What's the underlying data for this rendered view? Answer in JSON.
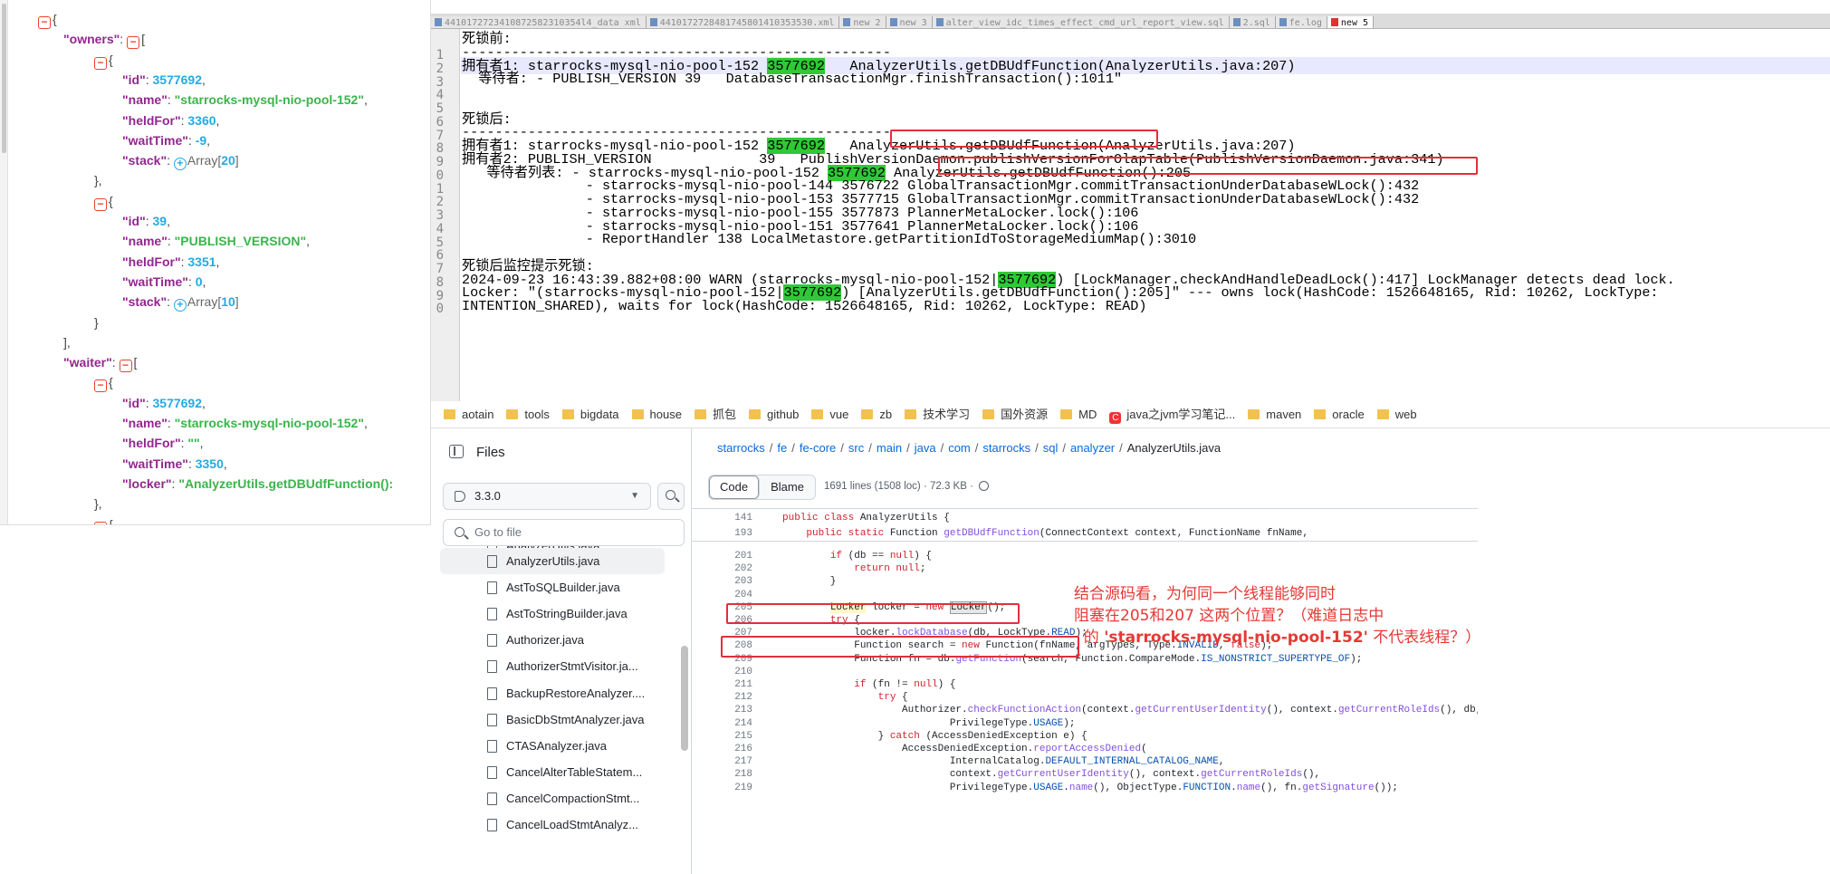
{
  "json_viewer": {
    "lines": [
      {
        "indent": 0,
        "parts": [
          {
            "t": "tog",
            "v": "−"
          },
          {
            "t": "txt",
            "v": "{"
          }
        ]
      },
      {
        "indent": 1,
        "parts": [
          {
            "t": "key",
            "v": "\"owners\""
          },
          {
            "t": "txt",
            "v": ": "
          },
          {
            "t": "tog",
            "v": "−"
          },
          {
            "t": "txt",
            "v": "["
          }
        ]
      },
      {
        "indent": 2,
        "parts": [
          {
            "t": "tog",
            "v": "−"
          },
          {
            "t": "txt",
            "v": "{"
          }
        ]
      },
      {
        "indent": 3,
        "parts": [
          {
            "t": "key",
            "v": "\"id\""
          },
          {
            "t": "txt",
            "v": ": "
          },
          {
            "t": "num",
            "v": "3577692"
          },
          {
            "t": "txt",
            "v": ","
          }
        ]
      },
      {
        "indent": 3,
        "parts": [
          {
            "t": "key",
            "v": "\"name\""
          },
          {
            "t": "txt",
            "v": ": "
          },
          {
            "t": "str",
            "v": "\"starrocks-mysql-nio-pool-152\""
          },
          {
            "t": "txt",
            "v": ","
          }
        ]
      },
      {
        "indent": 3,
        "parts": [
          {
            "t": "key",
            "v": "\"heldFor\""
          },
          {
            "t": "txt",
            "v": ": "
          },
          {
            "t": "num",
            "v": "3360"
          },
          {
            "t": "txt",
            "v": ","
          }
        ]
      },
      {
        "indent": 3,
        "parts": [
          {
            "t": "key",
            "v": "\"waitTime\""
          },
          {
            "t": "txt",
            "v": ": "
          },
          {
            "t": "num",
            "v": "-9"
          },
          {
            "t": "txt",
            "v": ","
          }
        ]
      },
      {
        "indent": 3,
        "parts": [
          {
            "t": "key",
            "v": "\"stack\""
          },
          {
            "t": "txt",
            "v": ": "
          },
          {
            "t": "plus",
            "v": "+"
          },
          {
            "t": "arr",
            "v": "Array["
          },
          {
            "t": "arrn",
            "v": "20"
          },
          {
            "t": "arr",
            "v": "]"
          }
        ]
      },
      {
        "indent": 2,
        "parts": [
          {
            "t": "txt",
            "v": "},"
          }
        ]
      },
      {
        "indent": 2,
        "parts": [
          {
            "t": "tog",
            "v": "−"
          },
          {
            "t": "txt",
            "v": "{"
          }
        ]
      },
      {
        "indent": 3,
        "parts": [
          {
            "t": "key",
            "v": "\"id\""
          },
          {
            "t": "txt",
            "v": ": "
          },
          {
            "t": "num",
            "v": "39"
          },
          {
            "t": "txt",
            "v": ","
          }
        ]
      },
      {
        "indent": 3,
        "parts": [
          {
            "t": "key",
            "v": "\"name\""
          },
          {
            "t": "txt",
            "v": ": "
          },
          {
            "t": "str",
            "v": "\"PUBLISH_VERSION\""
          },
          {
            "t": "txt",
            "v": ","
          }
        ]
      },
      {
        "indent": 3,
        "parts": [
          {
            "t": "key",
            "v": "\"heldFor\""
          },
          {
            "t": "txt",
            "v": ": "
          },
          {
            "t": "num",
            "v": "3351"
          },
          {
            "t": "txt",
            "v": ","
          }
        ]
      },
      {
        "indent": 3,
        "parts": [
          {
            "t": "key",
            "v": "\"waitTime\""
          },
          {
            "t": "txt",
            "v": ": "
          },
          {
            "t": "num",
            "v": "0"
          },
          {
            "t": "txt",
            "v": ","
          }
        ]
      },
      {
        "indent": 3,
        "parts": [
          {
            "t": "key",
            "v": "\"stack\""
          },
          {
            "t": "txt",
            "v": ": "
          },
          {
            "t": "plus",
            "v": "+"
          },
          {
            "t": "arr",
            "v": "Array["
          },
          {
            "t": "arrn",
            "v": "10"
          },
          {
            "t": "arr",
            "v": "]"
          }
        ]
      },
      {
        "indent": 2,
        "parts": [
          {
            "t": "txt",
            "v": "}"
          }
        ]
      },
      {
        "indent": 1,
        "parts": [
          {
            "t": "txt",
            "v": "],"
          }
        ]
      },
      {
        "indent": 1,
        "parts": [
          {
            "t": "key",
            "v": "\"waiter\""
          },
          {
            "t": "txt",
            "v": ": "
          },
          {
            "t": "tog",
            "v": "−"
          },
          {
            "t": "txt",
            "v": "["
          }
        ]
      },
      {
        "indent": 2,
        "parts": [
          {
            "t": "tog",
            "v": "−"
          },
          {
            "t": "txt",
            "v": "{"
          }
        ]
      },
      {
        "indent": 3,
        "parts": [
          {
            "t": "key",
            "v": "\"id\""
          },
          {
            "t": "txt",
            "v": ": "
          },
          {
            "t": "num",
            "v": "3577692"
          },
          {
            "t": "txt",
            "v": ","
          }
        ]
      },
      {
        "indent": 3,
        "parts": [
          {
            "t": "key",
            "v": "\"name\""
          },
          {
            "t": "txt",
            "v": ": "
          },
          {
            "t": "str",
            "v": "\"starrocks-mysql-nio-pool-152\""
          },
          {
            "t": "txt",
            "v": ","
          }
        ]
      },
      {
        "indent": 3,
        "parts": [
          {
            "t": "key",
            "v": "\"heldFor\""
          },
          {
            "t": "txt",
            "v": ": "
          },
          {
            "t": "str",
            "v": "\"\""
          },
          {
            "t": "txt",
            "v": ","
          }
        ]
      },
      {
        "indent": 3,
        "parts": [
          {
            "t": "key",
            "v": "\"waitTime\""
          },
          {
            "t": "txt",
            "v": ": "
          },
          {
            "t": "num",
            "v": "3350"
          },
          {
            "t": "txt",
            "v": ","
          }
        ]
      },
      {
        "indent": 3,
        "parts": [
          {
            "t": "key",
            "v": "\"locker\""
          },
          {
            "t": "txt",
            "v": ": "
          },
          {
            "t": "str",
            "v": "\"AnalyzerUtils.getDBUdfFunction():"
          }
        ]
      },
      {
        "indent": 2,
        "parts": [
          {
            "t": "txt",
            "v": "},"
          }
        ]
      },
      {
        "indent": 2,
        "parts": [
          {
            "t": "tog",
            "v": "−"
          },
          {
            "t": "txt",
            "v": "{"
          }
        ]
      }
    ]
  },
  "notepad": {
    "tabs": [
      {
        "label": "4410172723410872582310354l4_data xml",
        "active": false
      },
      {
        "label": "4410172728481745801410353530.xml",
        "active": false
      },
      {
        "label": "new 2",
        "active": false
      },
      {
        "label": "new 3",
        "active": false
      },
      {
        "label": "alter_view_idc_times_effect_cmd_url_report_view.sql",
        "active": false
      },
      {
        "label": "2.sql",
        "active": false
      },
      {
        "label": "fe.log",
        "active": false
      },
      {
        "label": "new 5",
        "active": true
      }
    ],
    "line_numbers": [
      "1",
      "2",
      "3",
      "4",
      "5",
      "6",
      "7",
      "8",
      "9",
      "0",
      "1",
      "2",
      "3",
      "4",
      "5",
      "6",
      "7",
      "8",
      "9",
      "0",
      ""
    ],
    "lines": [
      {
        "segs": [
          {
            "v": "死锁前:"
          }
        ]
      },
      {
        "segs": [
          {
            "v": "----------------------------------------------------"
          }
        ]
      },
      {
        "segs": [
          {
            "v": "拥有者1: starrocks-mysql-nio-pool-152 "
          },
          {
            "v": "3577692",
            "sel": true
          },
          {
            "v": "   AnalyzerUtils.getDBUdfFunction(AnalyzerUtils.java:207)"
          }
        ]
      },
      {
        "segs": [
          {
            "v": "  等待者: - PUBLISH_VERSION 39   DatabaseTransactionMgr.finishTransaction():1011\""
          }
        ]
      },
      {
        "segs": [
          {
            "v": ""
          }
        ]
      },
      {
        "segs": [
          {
            "v": ""
          }
        ]
      },
      {
        "segs": [
          {
            "v": "死锁后:"
          }
        ]
      },
      {
        "segs": [
          {
            "v": "----------------------------------------------------"
          }
        ]
      },
      {
        "segs": [
          {
            "v": "拥有者1: starrocks-mysql-nio-pool-152 "
          },
          {
            "v": "3577692",
            "sel": true
          },
          {
            "v": "   AnalyzerUtils.getDBUdfFunction(AnalyzerUtils.java:207)"
          }
        ]
      },
      {
        "segs": [
          {
            "v": "拥有者2: PUBLISH_VERSION             39   PublishVersionDaemon.publishVersionForOlapTable(PublishVersionDaemon.java:341)"
          }
        ]
      },
      {
        "segs": [
          {
            "v": "   等待者列表: - starrocks-mysql-nio-pool-152 "
          },
          {
            "v": "3577692",
            "sel": true
          },
          {
            "v": " AnalyzerUtils.getDBUdfFunction():205"
          }
        ]
      },
      {
        "segs": [
          {
            "v": "               - starrocks-mysql-nio-pool-144 3576722 GlobalTransactionMgr.commitTransactionUnderDatabaseWLock():432"
          }
        ]
      },
      {
        "segs": [
          {
            "v": "               - starrocks-mysql-nio-pool-153 3577715 GlobalTransactionMgr.commitTransactionUnderDatabaseWLock():432"
          }
        ]
      },
      {
        "segs": [
          {
            "v": "               - starrocks-mysql-nio-pool-155 3577873 PlannerMetaLocker.lock():106"
          }
        ]
      },
      {
        "segs": [
          {
            "v": "               - starrocks-mysql-nio-pool-151 3577641 PlannerMetaLocker.lock():106"
          }
        ]
      },
      {
        "segs": [
          {
            "v": "               - ReportHandler 138 LocalMetastore.getPartitionIdToStorageMediumMap():3010"
          }
        ]
      },
      {
        "segs": [
          {
            "v": ""
          }
        ]
      },
      {
        "segs": [
          {
            "v": "死锁后监控提示死锁:"
          }
        ]
      },
      {
        "segs": [
          {
            "v": "2024-09-23 16:43:39.882+08:00 WARN (starrocks-mysql-nio-pool-152|"
          },
          {
            "v": "3577692",
            "sel": true
          },
          {
            "v": ") [LockManager.checkAndHandleDeadLock():417] LockManager detects dead lock."
          }
        ]
      },
      {
        "segs": [
          {
            "v": "Locker: \"(starrocks-mysql-nio-pool-152|"
          },
          {
            "v": "3577692",
            "sel": true
          },
          {
            "v": ") [AnalyzerUtils.getDBUdfFunction():205]\" --- owns lock(HashCode: 1526648165, Rid: 10262, LockType:"
          }
        ]
      },
      {
        "segs": [
          {
            "v": "INTENTION_SHARED), waits for lock(HashCode: 1526648165, Rid: 10262, LockType: READ)"
          }
        ]
      }
    ]
  },
  "bookmarks": [
    {
      "label": "aotain",
      "icon": "folder"
    },
    {
      "label": "tools",
      "icon": "folder"
    },
    {
      "label": "bigdata",
      "icon": "folder"
    },
    {
      "label": "house",
      "icon": "folder"
    },
    {
      "label": "抓包",
      "icon": "folder"
    },
    {
      "label": "github",
      "icon": "folder"
    },
    {
      "label": "vue",
      "icon": "folder"
    },
    {
      "label": "zb",
      "icon": "folder"
    },
    {
      "label": "技术学习",
      "icon": "folder"
    },
    {
      "label": "国外资源",
      "icon": "folder"
    },
    {
      "label": "MD",
      "icon": "folder"
    },
    {
      "label": "java之jvm学习笔记...",
      "icon": "csdn"
    },
    {
      "label": "maven",
      "icon": "folder"
    },
    {
      "label": "oracle",
      "icon": "folder"
    },
    {
      "label": "web",
      "icon": "folder"
    }
  ],
  "github": {
    "files_label": "Files",
    "branch": "3.3.0",
    "goto_placeholder": "Go to file",
    "tree": [
      {
        "label": "AnalyzerUtils.java",
        "active": false,
        "partial": true
      },
      {
        "label": "AnalyzerUtils.java",
        "active": true
      },
      {
        "label": "AstToSQLBuilder.java",
        "active": false
      },
      {
        "label": "AstToStringBuilder.java",
        "active": false
      },
      {
        "label": "Authorizer.java",
        "active": false
      },
      {
        "label": "AuthorizerStmtVisitor.ja...",
        "active": false
      },
      {
        "label": "BackupRestoreAnalyzer....",
        "active": false
      },
      {
        "label": "BasicDbStmtAnalyzer.java",
        "active": false
      },
      {
        "label": "CTASAnalyzer.java",
        "active": false
      },
      {
        "label": "CancelAlterTableStatem...",
        "active": false
      },
      {
        "label": "CancelCompactionStmt...",
        "active": false
      },
      {
        "label": "CancelLoadStmtAnalyz...",
        "active": false
      }
    ],
    "breadcrumb": [
      "starrocks",
      "fe",
      "fe-core",
      "src",
      "main",
      "java",
      "com",
      "starrocks",
      "sql",
      "analyzer"
    ],
    "breadcrumb_current": "AnalyzerUtils.java",
    "code_tab": "Code",
    "blame_tab": "Blame",
    "meta": "1691 lines (1508 loc) · 72.3 KB ·",
    "code_lines": [
      {
        "n": "141",
        "html": "<span class='kw'>public class</span> AnalyzerUtils {"
      },
      {
        "n": "193",
        "html": "    <span class='kw'>public static</span> Function <span class='fn'>getDBUdfFunction</span>(ConnectContext context, FunctionName fnName,"
      },
      {
        "n": "201",
        "html": "        <span class='kw'>if</span> (db == <span class='kw'>null</span>) {"
      },
      {
        "n": "202",
        "html": "            <span class='kw'>return null</span>;"
      },
      {
        "n": "203",
        "html": "        }"
      },
      {
        "n": "204",
        "html": ""
      },
      {
        "n": "205",
        "html": "        <span class='hlw'>Locker</span> locker = <span class='kw'>new</span> <span class='hlw2'>Locker</span>();"
      },
      {
        "n": "206",
        "html": "        <span class='kw'>try</span> {"
      },
      {
        "n": "207",
        "html": "            locker.<span class='fn'>lockDatabase</span>(db, LockType.<span class='cst'>READ</span>);"
      },
      {
        "n": "208",
        "html": "            Function search = <span class='kw'>new</span> Function(fnName, argTypes, Type.<span class='cst'>INVALID</span>, <span class='kw'>false</span>);"
      },
      {
        "n": "209",
        "html": "            Function fn = db.<span class='fn'>getFunction</span>(search, Function.CompareMode.<span class='cst'>IS_NONSTRICT_SUPERTYPE_OF</span>);"
      },
      {
        "n": "210",
        "html": ""
      },
      {
        "n": "211",
        "html": "            <span class='kw'>if</span> (fn != <span class='kw'>null</span>) {"
      },
      {
        "n": "212",
        "html": "                <span class='kw'>try</span> {"
      },
      {
        "n": "213",
        "html": "                    Authorizer.<span class='fn'>checkFunctionAction</span>(context.<span class='fn'>getCurrentUserIdentity</span>(), context.<span class='fn'>getCurrentRoleIds</span>(), db, fn,"
      },
      {
        "n": "214",
        "html": "                            PrivilegeType.<span class='cst'>USAGE</span>);"
      },
      {
        "n": "215",
        "html": "                } <span class='kw'>catch</span> (AccessDeniedException e) {"
      },
      {
        "n": "216",
        "html": "                    AccessDeniedException.<span class='fn'>reportAccessDenied</span>("
      },
      {
        "n": "217",
        "html": "                            InternalCatalog.<span class='cst'>DEFAULT_INTERNAL_CATALOG_NAME</span>,"
      },
      {
        "n": "218",
        "html": "                            context.<span class='fn'>getCurrentUserIdentity</span>(), context.<span class='fn'>getCurrentRoleIds</span>(),"
      },
      {
        "n": "219",
        "html": "                            PrivilegeType.<span class='cst'>USAGE</span>.<span class='fn'>name</span>(), ObjectType.<span class='cst'>FUNCTION</span>.<span class='fn'>name</span>(), fn.<span class='fn'>getSignature</span>());"
      }
    ]
  },
  "annotation": {
    "line1": "结合源码看，为何同一个线程能够同时",
    "line2": "阻塞在205和207 这两个位置？（难道日志中",
    "line3_pre": "  的 ",
    "line3_quote": "'starrocks-mysql-nio-pool-152'",
    "line3_post": " 不代表线程？）"
  }
}
